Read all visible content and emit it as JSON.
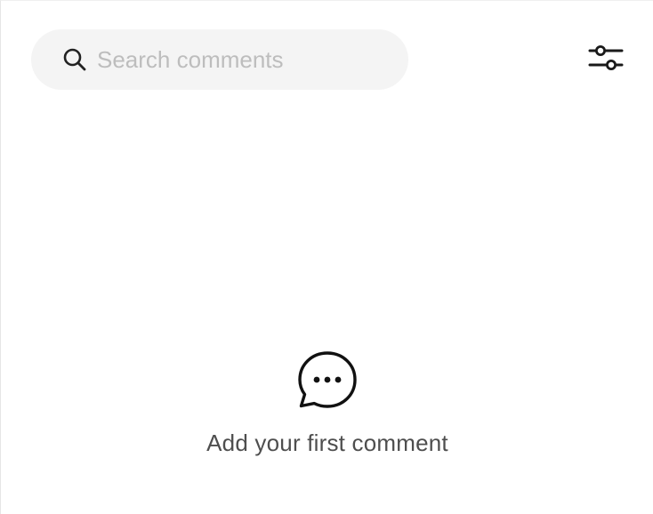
{
  "search": {
    "placeholder": "Search comments",
    "value": "",
    "icon": "search-icon"
  },
  "toolbar": {
    "filter_icon": "sliders-icon"
  },
  "empty_state": {
    "icon": "comment-bubble-icon",
    "message": "Add your first comment"
  }
}
